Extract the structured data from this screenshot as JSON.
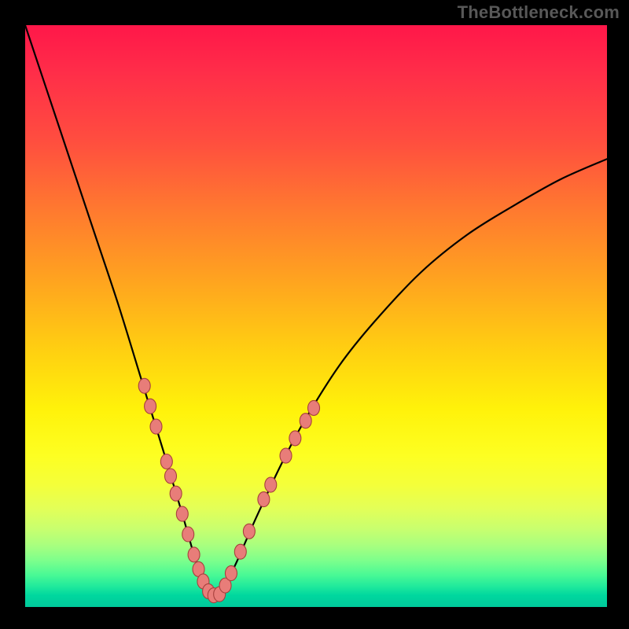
{
  "watermark": "TheBottleneck.com",
  "chart_data": {
    "type": "line",
    "title": "",
    "xlabel": "",
    "ylabel": "",
    "xlim": [
      0,
      100
    ],
    "ylim": [
      0,
      100
    ],
    "grid": false,
    "legend": false,
    "series": [
      {
        "name": "bottleneck-curve",
        "x": [
          0,
          4,
          8,
          12,
          16,
          20,
          22,
          24,
          25.5,
          27,
          28,
          29,
          30,
          31,
          32,
          33,
          34,
          36,
          38,
          40,
          44,
          48,
          54,
          60,
          68,
          76,
          84,
          92,
          100
        ],
        "y": [
          100,
          88,
          76,
          64,
          52,
          39,
          32.5,
          26,
          21,
          16,
          12.5,
          9,
          6,
          3.5,
          2,
          2,
          3.5,
          7,
          11.5,
          16,
          24.5,
          32,
          41.5,
          49,
          57.5,
          64,
          69,
          73.5,
          77
        ]
      }
    ],
    "markers": {
      "name": "highlighted-points",
      "points": [
        {
          "x": 20.5,
          "y": 38
        },
        {
          "x": 21.5,
          "y": 34.5
        },
        {
          "x": 22.5,
          "y": 31
        },
        {
          "x": 24.3,
          "y": 25
        },
        {
          "x": 25.0,
          "y": 22.5
        },
        {
          "x": 25.9,
          "y": 19.5
        },
        {
          "x": 27.0,
          "y": 16
        },
        {
          "x": 28.0,
          "y": 12.5
        },
        {
          "x": 29.0,
          "y": 9
        },
        {
          "x": 29.8,
          "y": 6.5
        },
        {
          "x": 30.6,
          "y": 4.4
        },
        {
          "x": 31.5,
          "y": 2.7
        },
        {
          "x": 32.4,
          "y": 2.0
        },
        {
          "x": 33.4,
          "y": 2.2
        },
        {
          "x": 34.4,
          "y": 3.7
        },
        {
          "x": 35.4,
          "y": 5.8
        },
        {
          "x": 37.0,
          "y": 9.5
        },
        {
          "x": 38.5,
          "y": 13
        },
        {
          "x": 41.0,
          "y": 18.5
        },
        {
          "x": 42.2,
          "y": 21
        },
        {
          "x": 44.8,
          "y": 26
        },
        {
          "x": 46.4,
          "y": 29
        },
        {
          "x": 48.2,
          "y": 32
        },
        {
          "x": 49.6,
          "y": 34.2
        }
      ]
    },
    "background": "vertical-rainbow-gradient",
    "annotations": []
  }
}
